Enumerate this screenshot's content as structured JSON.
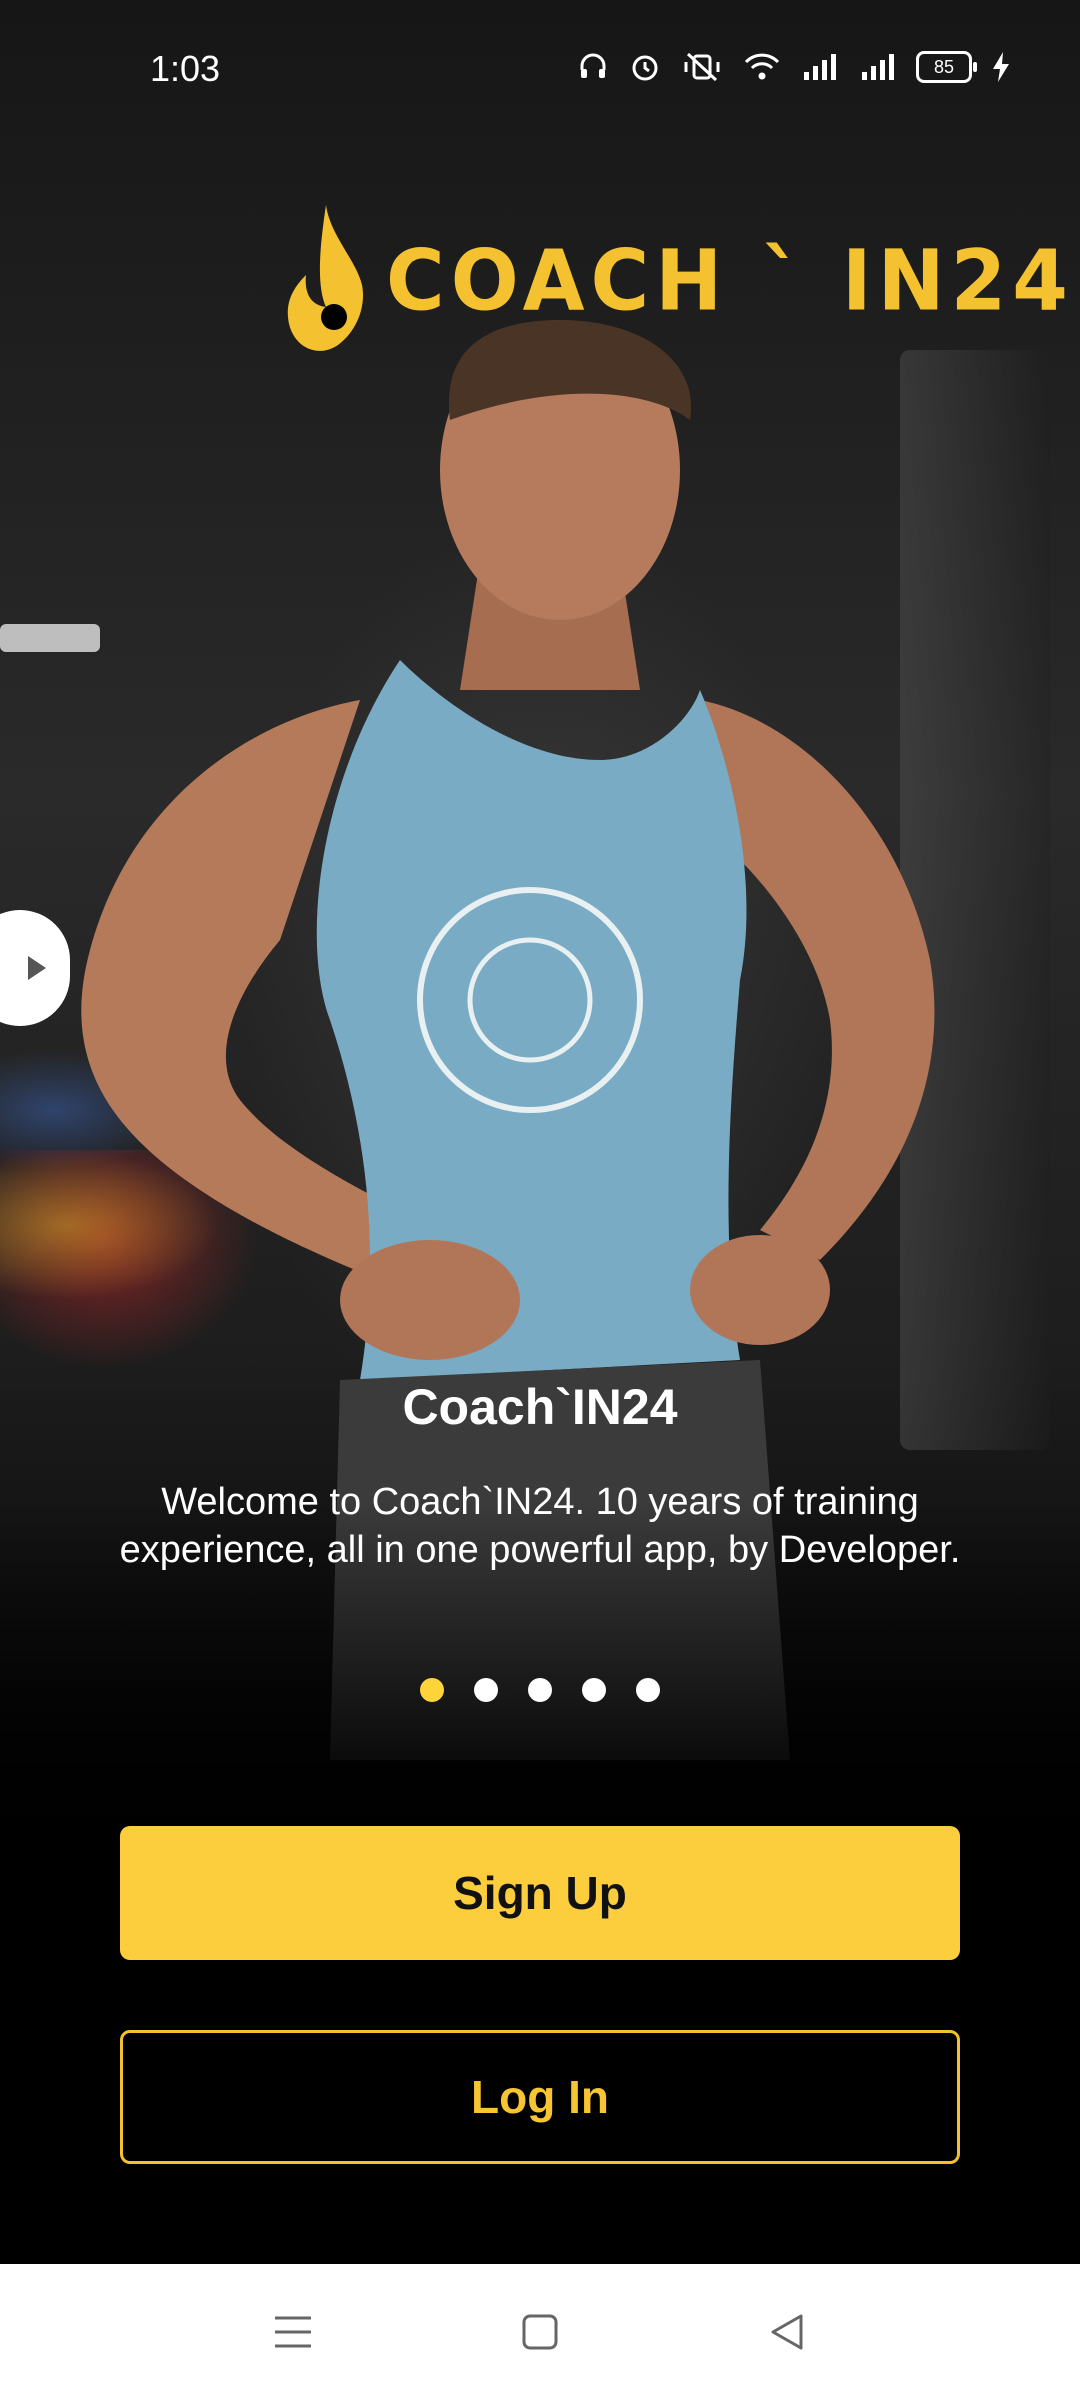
{
  "status_bar": {
    "time": "1:03",
    "battery": "85",
    "icons": [
      "headset-icon",
      "alarm-icon",
      "vibrate-off-icon",
      "wifi-icon",
      "signal-icon",
      "signal-icon",
      "battery-icon",
      "charging-icon"
    ]
  },
  "brand": {
    "logo_text": "COACH ` IN24",
    "accent_color": "#FCCD3C"
  },
  "onboarding": {
    "title": "Coach`IN24",
    "description": "Welcome to Coach`IN24. 10 years of training experience, all in one powerful app, by Developer.",
    "page_count": 5,
    "active_page": 1
  },
  "actions": {
    "signup_label": "Sign Up",
    "login_label": "Log In"
  },
  "nav_bar": {
    "icons": [
      "menu-icon",
      "home-icon",
      "back-icon"
    ]
  }
}
